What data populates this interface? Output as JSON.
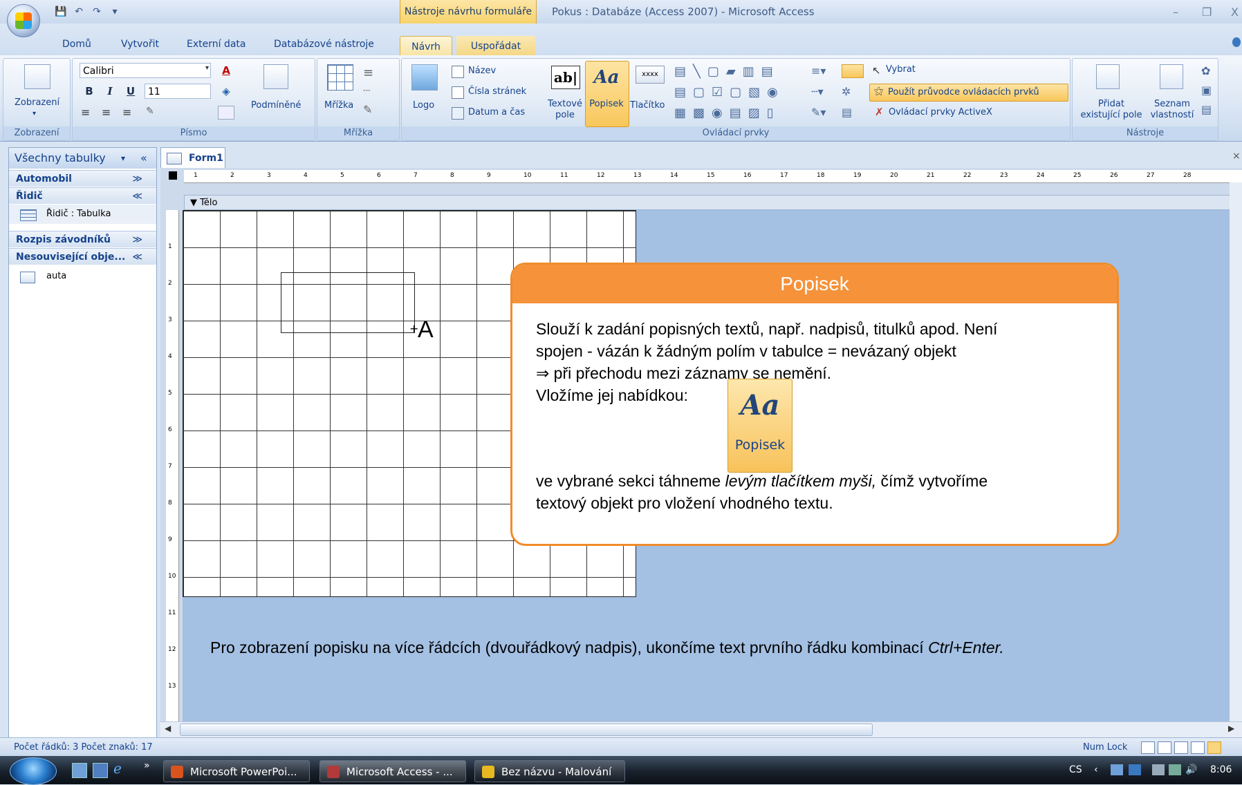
{
  "window": {
    "title": "Pokus : Databáze (Access 2007) - Microsoft Access",
    "context_tab_title": "Nástroje návrhu formuláře",
    "minimize_label": "–",
    "restore_label": "❐",
    "close_label": "X"
  },
  "ribbon_tabs": [
    "Domů",
    "Vytvořit",
    "Externí data",
    "Databázové nástroje",
    "Návrh",
    "Uspořádat"
  ],
  "ribbon": {
    "zobrazeni": {
      "button_label": "Zobrazení",
      "group_label": "Zobrazení"
    },
    "pismo": {
      "font_name": "Calibri",
      "font_size": "11",
      "conditional_label": "Podmíněné",
      "group_label": "Písmo",
      "bold": "B",
      "italic": "I",
      "underline": "U",
      "font_color": "A"
    },
    "mrizka": {
      "button_label": "Mřížka",
      "group_label": "Mřížka"
    },
    "ovladaci_prvky": {
      "group_label": "Ovládací prvky",
      "logo_label": "Logo",
      "nazev_label": "Název",
      "cisla_stranek_label": "Čísla stránek",
      "datum_cas_label": "Datum a čas",
      "textove_pole_line1": "Textové",
      "textove_pole_line2": "pole",
      "textbox_icon_text": "ab|",
      "popisek_label": "Popisek",
      "popisek_icon_text": "Aa",
      "tlacitko_label": "Tlačítko",
      "tlacitko_icon_text": "xxxx",
      "vybrat_label": "Vybrat",
      "pruvodce_label": "Použít průvodce ovládacích prvků",
      "activex_label": "Ovládací prvky ActiveX"
    },
    "nastroje": {
      "group_label": "Nástroje",
      "pridat_line1": "Přidat",
      "pridat_line2": "existující pole",
      "seznam_line1": "Seznam",
      "seznam_line2": "vlastností"
    }
  },
  "nav_pane": {
    "header": "Všechny tabulky",
    "groups": [
      {
        "label": "Automobil",
        "chevron": "≫"
      },
      {
        "label": "Řidič",
        "chevron": "≪",
        "items": [
          {
            "label": "Řidič : Tabulka"
          }
        ]
      },
      {
        "label": "Rozpis závodníků",
        "chevron": "≫"
      },
      {
        "label": "Nesouvisející obje...",
        "chevron": "≪",
        "items": [
          {
            "label": "auta"
          }
        ]
      }
    ]
  },
  "document": {
    "tab_label": "Form1",
    "section_label": "Tělo",
    "cursor_letter": "A",
    "ruler_numbers": [
      "1",
      "2",
      "3",
      "4",
      "5",
      "6",
      "7",
      "8",
      "9",
      "10",
      "11",
      "12",
      "13",
      "14",
      "15",
      "16",
      "17",
      "18",
      "19",
      "20",
      "21",
      "22",
      "23",
      "24",
      "25",
      "26",
      "27",
      "28"
    ],
    "vruler_numbers": [
      "1",
      "2",
      "3",
      "4",
      "5",
      "6",
      "7",
      "8",
      "9",
      "10",
      "11",
      "12",
      "13"
    ]
  },
  "callout": {
    "title": "Popisek",
    "line1": "Slouží  k zadání popisných textů, např. nadpisů, titulků apod. Není",
    "line2": "spojen - vázán k žádným polím v tabulce = nevázaný objekt",
    "line3": "⇒ při přechodu mezi záznamy se nemění.",
    "line4": "Vložíme jej nabídkou:",
    "inner_button_icon": "Aa",
    "inner_button_label": "Popisek",
    "line5_a": "ve vybrané sekci táhneme ",
    "line5_em": "levým tlačítkem myši,",
    "line5_b": " čímž vytvoříme",
    "line6": "textový objekt pro vložení vhodného textu."
  },
  "bottom_note": {
    "text": "Pro zobrazení popisku na více řádcích (dvouřádkový nadpis), ukončíme text prvního řádku kombinací ",
    "em": "Ctrl+Enter."
  },
  "status": {
    "left": "Počet řádků: 3 Počet znaků: 17",
    "num_lock": "Num Lock"
  },
  "taskbar": {
    "items": [
      {
        "label": "Microsoft PowerPoi...",
        "color": "#d9531e"
      },
      {
        "label": "Microsoft Access - ...",
        "color": "#b23a3a"
      },
      {
        "label": "Bez názvu - Malování",
        "color": "#e8b820"
      }
    ],
    "lang": "CS",
    "time": "8:06"
  }
}
